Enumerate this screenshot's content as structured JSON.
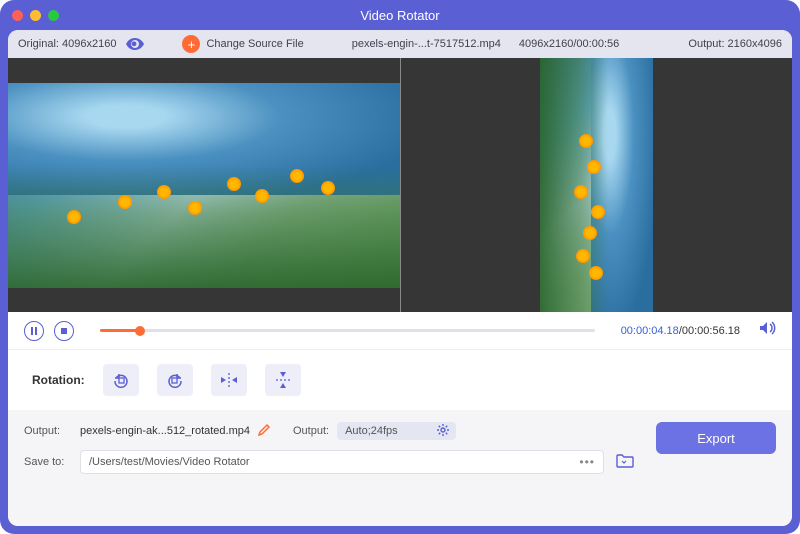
{
  "window": {
    "title": "Video Rotator"
  },
  "topbar": {
    "original_label": "Original: 4096x2160",
    "change_label": "Change Source File",
    "file_name": "pexels-engin-...t-7517512.mp4",
    "file_info": "4096x2160/00:00:56",
    "output_label": "Output: 2160x4096"
  },
  "playback": {
    "current": "00:00:04.18",
    "total": "00:00:56.18",
    "progress_pct": 8
  },
  "rotation": {
    "label": "Rotation:",
    "btn1": "rotate-ccw",
    "btn2": "rotate-cw",
    "btn3": "flip-horizontal",
    "btn4": "flip-vertical"
  },
  "output": {
    "label": "Output:",
    "file": "pexels-engin-ak...512_rotated.mp4",
    "format_label": "Output:",
    "format_value": "Auto;24fps"
  },
  "save": {
    "label": "Save to:",
    "path": "/Users/test/Movies/Video Rotator"
  },
  "actions": {
    "export": "Export"
  },
  "colors": {
    "purple": "#5a5fd4",
    "orange": "#ff6b35"
  }
}
